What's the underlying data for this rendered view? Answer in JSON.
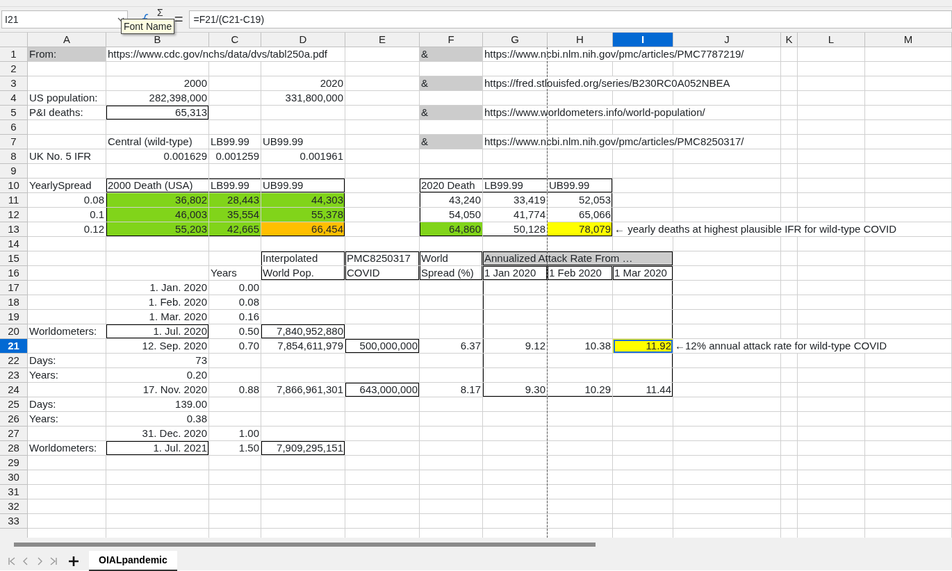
{
  "formula_bar": {
    "name_box": "I21",
    "sum_symbol": "Σ",
    "equals_sign": "=",
    "formula": "=F21/(C21-C19)"
  },
  "tooltip": {
    "text": "Font Name"
  },
  "columns": [
    {
      "label": "A",
      "selected": false
    },
    {
      "label": "B",
      "selected": false
    },
    {
      "label": "C",
      "selected": false
    },
    {
      "label": "D",
      "selected": false
    },
    {
      "label": "E",
      "selected": false
    },
    {
      "label": "F",
      "selected": false
    },
    {
      "label": "G",
      "selected": false
    },
    {
      "label": "H",
      "selected": false
    },
    {
      "label": "I",
      "selected": true
    },
    {
      "label": "J",
      "selected": false
    },
    {
      "label": "K",
      "selected": false
    },
    {
      "label": "L",
      "selected": false
    },
    {
      "label": "M",
      "selected": false
    }
  ],
  "rows": [
    {
      "number": "1",
      "selected": false,
      "cells": [
        {
          "text": "From:",
          "color": "#cccccc"
        },
        {
          "text": "https://www.cdc.gov/nchs/data/dvs/tabl250a.pdf"
        },
        null,
        null,
        null,
        {
          "text": "&",
          "color": "#cccccc"
        },
        {
          "text": "https://www.ncbi.nlm.nih.gov/pmc/articles/PMC7787219/"
        }
      ]
    },
    {
      "number": "2",
      "selected": false
    },
    {
      "number": "3",
      "selected": false,
      "cells": [
        null,
        {
          "text": "2000",
          "right_aligned": true
        },
        null,
        {
          "text": "2020",
          "right_aligned": true
        },
        null,
        {
          "text": "&",
          "color": "#cccccc"
        },
        {
          "text": "https://fred.stlouisfed.org/series/B230RC0A052NBEA"
        }
      ]
    },
    {
      "number": "4",
      "selected": false,
      "cells": [
        {
          "text": "US population:"
        },
        {
          "text": "282,398,000",
          "right_aligned": true
        },
        null,
        {
          "text": "331,800,000",
          "right_aligned": true
        }
      ]
    },
    {
      "number": "5",
      "selected": false,
      "cells": [
        {
          "text": "P&I deaths:"
        },
        {
          "text": "65,313",
          "right_aligned": true,
          "boxed": true
        },
        null,
        null,
        null,
        {
          "text": "&",
          "color": "#cccccc"
        },
        {
          "text": "https://www.worldometers.info/world-population/"
        }
      ]
    },
    {
      "number": "6",
      "selected": false
    },
    {
      "number": "7",
      "selected": false,
      "cells": [
        null,
        {
          "text": "Central (wild-type)"
        },
        {
          "text": "LB99.99"
        },
        {
          "text": "UB99.99"
        },
        null,
        {
          "text": "&",
          "color": "#cccccc"
        },
        {
          "text": "https://www.ncbi.nlm.nih.gov/pmc/articles/PMC8250317/"
        }
      ]
    },
    {
      "number": "8",
      "selected": false,
      "cells": [
        {
          "text": "UK No. 5 IFR"
        },
        {
          "text": "0.001629",
          "right_aligned": true
        },
        {
          "text": "0.001259",
          "right_aligned": true
        },
        {
          "text": "0.001961",
          "right_aligned": true
        }
      ]
    },
    {
      "number": "9",
      "selected": false
    },
    {
      "number": "10",
      "selected": false,
      "cells": [
        {
          "text": "YearlySpread"
        },
        {
          "text": "2000 Death (USA)",
          "border_top": true,
          "border_bottom": true,
          "border_left": true
        },
        {
          "text": "LB99.99",
          "border_top": true,
          "border_bottom": true
        },
        {
          "text": "UB99.99",
          "border_top": true,
          "border_bottom": true,
          "border_right": true
        },
        null,
        {
          "text": "2020 Death",
          "border_top": true,
          "border_bottom": true,
          "border_left": true
        },
        {
          "text": "LB99.99",
          "border_top": true,
          "border_bottom": true
        },
        {
          "text": "UB99.99",
          "border_top": true,
          "border_bottom": true,
          "border_right": true
        }
      ]
    },
    {
      "number": "11",
      "selected": false,
      "cells": [
        {
          "text": "0.08",
          "right_aligned": true
        },
        {
          "text": "36,802",
          "right_aligned": true,
          "color": "#81d41a",
          "border_left": true
        },
        {
          "text": "28,443",
          "right_aligned": true,
          "color": "#81d41a"
        },
        {
          "text": "44,303",
          "right_aligned": true,
          "color": "#81d41a",
          "border_right": true
        },
        null,
        {
          "text": "43,240",
          "right_aligned": true,
          "border_left": true
        },
        {
          "text": "33,419",
          "right_aligned": true
        },
        {
          "text": "52,053",
          "right_aligned": true,
          "border_right": true
        }
      ]
    },
    {
      "number": "12",
      "selected": false,
      "cells": [
        {
          "text": "0.1",
          "right_aligned": true
        },
        {
          "text": "46,003",
          "right_aligned": true,
          "color": "#81d41a",
          "border_left": true
        },
        {
          "text": "35,554",
          "right_aligned": true,
          "color": "#81d41a"
        },
        {
          "text": "55,378",
          "right_aligned": true,
          "color": "#81d41a",
          "border_right": true
        },
        null,
        {
          "text": "54,050",
          "right_aligned": true,
          "border_left": true
        },
        {
          "text": "41,774",
          "right_aligned": true
        },
        {
          "text": "65,066",
          "right_aligned": true,
          "border_right": true
        }
      ]
    },
    {
      "number": "13",
      "selected": false,
      "cells": [
        {
          "text": "0.12",
          "right_aligned": true
        },
        {
          "text": "55,203",
          "right_aligned": true,
          "color": "#81d41a",
          "border_left": true,
          "border_bottom": true
        },
        {
          "text": "42,665",
          "right_aligned": true,
          "color": "#81d41a",
          "border_bottom": true
        },
        {
          "text": "66,454",
          "right_aligned": true,
          "color": "#ffbf00",
          "border_right": true,
          "border_bottom": true
        },
        null,
        {
          "text": "64,860",
          "right_aligned": true,
          "color": "#81d41a",
          "border_left": true,
          "border_bottom": true
        },
        {
          "text": "50,128",
          "right_aligned": true,
          "border_bottom": true
        },
        {
          "text": "78,079",
          "right_aligned": true,
          "color": "#ffff00",
          "border_right": true,
          "border_bottom": true
        },
        {
          "text": "← yearly deaths at highest plausible IFR for wild-type COVID"
        }
      ]
    },
    {
      "number": "14",
      "selected": false
    },
    {
      "number": "15",
      "selected": false,
      "cells": [
        null,
        null,
        null,
        {
          "text": "Interpolated",
          "border_top": true,
          "border_left": true,
          "border_right": true
        },
        {
          "text": "PMC8250317",
          "border_top": true,
          "border_left": true,
          "border_right": true
        },
        {
          "text": "World",
          "border_top": true,
          "border_left": true,
          "border_right": true
        },
        {
          "text": "Annualized Attack Rate From …",
          "color": "#cccccc",
          "boxed": true
        },
        {
          "covered": true
        },
        {
          "covered": true
        }
      ]
    },
    {
      "number": "16",
      "selected": false,
      "cells": [
        null,
        null,
        {
          "text": "Years"
        },
        {
          "text": "World Pop.",
          "border_bottom": true,
          "border_left": true,
          "border_right": true
        },
        {
          "text": "COVID",
          "border_bottom": true,
          "border_left": true,
          "border_right": true
        },
        {
          "text": "Spread (%)",
          "border_bottom": true,
          "border_left": true,
          "border_right": true
        },
        {
          "text": "1 Jan 2020",
          "boxed": true
        },
        {
          "text": "1 Feb 2020",
          "boxed": true
        },
        {
          "text": "1 Mar 2020",
          "boxed": true
        }
      ]
    },
    {
      "number": "17",
      "selected": false,
      "cells": [
        null,
        {
          "text": "1. Jan. 2020",
          "right_aligned": true
        },
        {
          "text": "0.00",
          "right_aligned": true
        },
        null,
        null,
        null,
        {
          "border_left": true
        },
        null,
        {
          "border_right": true
        }
      ]
    },
    {
      "number": "18",
      "selected": false,
      "cells": [
        null,
        {
          "text": "1. Feb. 2020",
          "right_aligned": true
        },
        {
          "text": "0.08",
          "right_aligned": true
        },
        null,
        null,
        null,
        {
          "border_left": true
        },
        null,
        {
          "border_right": true
        }
      ]
    },
    {
      "number": "19",
      "selected": false,
      "cells": [
        null,
        {
          "text": "1. Mar. 2020",
          "right_aligned": true
        },
        {
          "text": "0.16",
          "right_aligned": true
        },
        null,
        null,
        null,
        {
          "border_left": true
        },
        null,
        {
          "border_right": true
        }
      ]
    },
    {
      "number": "20",
      "selected": false,
      "cells": [
        {
          "text": "Worldometers:"
        },
        {
          "text": "1. Jul. 2020",
          "right_aligned": true,
          "boxed": true
        },
        {
          "text": "0.50",
          "right_aligned": true
        },
        {
          "text": "7,840,952,880",
          "right_aligned": true,
          "boxed": true
        },
        null,
        null,
        {
          "border_left": true
        },
        null,
        {
          "border_right": true
        }
      ]
    },
    {
      "number": "21",
      "selected": true,
      "cells": [
        null,
        {
          "text": "12. Sep. 2020",
          "right_aligned": true
        },
        {
          "text": "0.70",
          "right_aligned": true
        },
        {
          "text": "7,854,611,979",
          "right_aligned": true
        },
        {
          "text": "500,000,000",
          "right_aligned": true,
          "boxed": true
        },
        {
          "text": "6.37",
          "right_aligned": true
        },
        {
          "text": "9.12",
          "right_aligned": true,
          "border_left": true
        },
        {
          "text": "10.38",
          "right_aligned": true
        },
        {
          "text": "11.92",
          "right_aligned": true,
          "color": "#ffff00",
          "active": true
        },
        {
          "text": "←12% annual attack rate for wild-type COVID"
        }
      ]
    },
    {
      "number": "22",
      "selected": false,
      "cells": [
        {
          "text": "Days:"
        },
        {
          "text": "73",
          "right_aligned": true
        },
        null,
        null,
        null,
        null,
        {
          "border_left": true
        },
        null,
        {
          "border_right": true
        }
      ]
    },
    {
      "number": "23",
      "selected": false,
      "cells": [
        {
          "text": "Years:"
        },
        {
          "text": "0.20",
          "right_aligned": true
        },
        null,
        null,
        null,
        null,
        {
          "border_left": true
        },
        null,
        {
          "border_right": true
        }
      ]
    },
    {
      "number": "24",
      "selected": false,
      "cells": [
        null,
        {
          "text": "17. Nov. 2020",
          "right_aligned": true
        },
        {
          "text": "0.88",
          "right_aligned": true
        },
        {
          "text": "7,866,961,301",
          "right_aligned": true
        },
        {
          "text": "643,000,000",
          "right_aligned": true,
          "boxed": true
        },
        {
          "text": "8.17",
          "right_aligned": true
        },
        {
          "text": "9.30",
          "right_aligned": true,
          "border_left": true,
          "border_bottom": true
        },
        {
          "text": "10.29",
          "right_aligned": true,
          "border_bottom": true
        },
        {
          "text": "11.44",
          "right_aligned": true,
          "border_right": true,
          "border_bottom": true
        }
      ]
    },
    {
      "number": "25",
      "selected": false,
      "cells": [
        {
          "text": "Days:"
        },
        {
          "text": "139.00",
          "right_aligned": true
        }
      ]
    },
    {
      "number": "26",
      "selected": false,
      "cells": [
        {
          "text": "Years:"
        },
        {
          "text": "0.38",
          "right_aligned": true
        }
      ]
    },
    {
      "number": "27",
      "selected": false,
      "cells": [
        null,
        {
          "text": "31. Dec. 2020",
          "right_aligned": true
        },
        {
          "text": "1.00",
          "right_aligned": true
        }
      ]
    },
    {
      "number": "28",
      "selected": false,
      "cells": [
        {
          "text": "Worldometers:"
        },
        {
          "text": "1. Jul. 2021",
          "right_aligned": true,
          "boxed": true
        },
        {
          "text": "1.50",
          "right_aligned": true
        },
        {
          "text": "7,909,295,151",
          "right_aligned": true,
          "boxed": true
        }
      ]
    },
    {
      "number": "29",
      "selected": false
    },
    {
      "number": "30",
      "selected": false
    },
    {
      "number": "31",
      "selected": false
    },
    {
      "number": "32",
      "selected": false
    },
    {
      "number": "33",
      "selected": false
    }
  ],
  "sheet_tabs": [
    {
      "label": "OIALpandemic",
      "selected": true
    }
  ]
}
